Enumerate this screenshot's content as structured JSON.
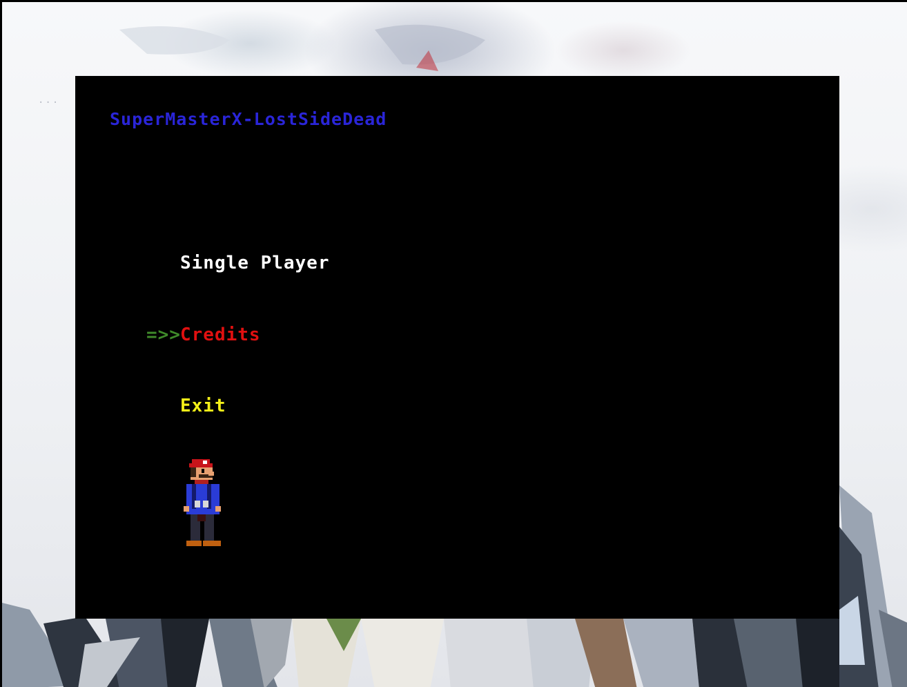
{
  "game": {
    "title": "SuperMasterX-LostSideDead",
    "menu": {
      "cursor": "=>>",
      "items": [
        {
          "label": "Single Player",
          "color": "#ffffff",
          "selected": false
        },
        {
          "label": "Credits",
          "color": "#e01010",
          "selected": true
        },
        {
          "label": "Exit",
          "color": "#f4f018",
          "selected": false
        }
      ]
    },
    "colors": {
      "title": "#2a25d8",
      "cursor": "#3f8a2a",
      "screen_background": "#000000"
    },
    "sprite": "plumber-character"
  },
  "background": {
    "dots": "..."
  }
}
